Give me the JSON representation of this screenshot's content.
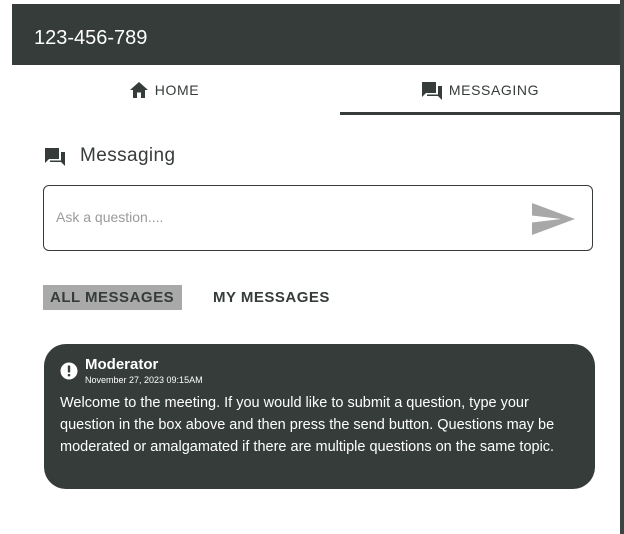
{
  "header": {
    "title": "123-456-789"
  },
  "tabs": [
    {
      "label": "HOME",
      "icon": "home-icon",
      "active": false
    },
    {
      "label": "MESSAGING",
      "icon": "forum-icon",
      "active": true
    }
  ],
  "messaging": {
    "title": "Messaging",
    "icon": "forum-icon",
    "input": {
      "value": "",
      "placeholder": "Ask a question...."
    },
    "send_icon": "send-icon",
    "filters": [
      {
        "label": "ALL MESSAGES",
        "selected": true
      },
      {
        "label": "MY MESSAGES",
        "selected": false
      }
    ],
    "messages": [
      {
        "author": "Moderator",
        "timestamp": "November 27, 2023 09:15AM",
        "icon": "alert-icon",
        "body": "Welcome to the meeting. If you would like to submit a question, type your question in the box above and then press the send button. Questions may be moderated or amalgamated if there are multiple questions on the same topic."
      }
    ]
  },
  "colors": {
    "primary_dark": "#353c3a",
    "selected_filter_bg": "#a9a9a9",
    "send_icon": "#a8a8a8",
    "placeholder": "#9a9a9a"
  }
}
